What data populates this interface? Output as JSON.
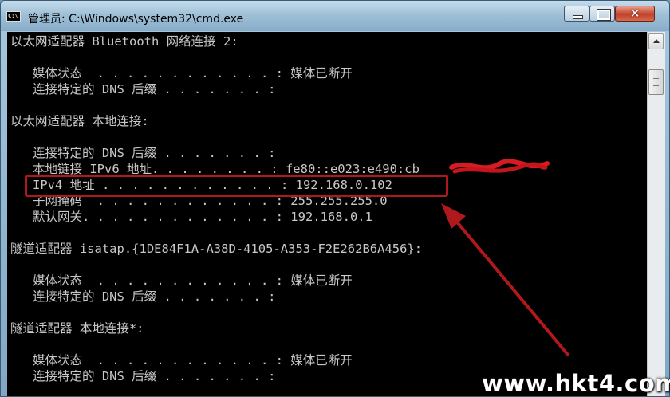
{
  "window": {
    "title": "管理员: C:\\Windows\\system32\\cmd.exe",
    "icon": "cmd-icon",
    "close_label": "×"
  },
  "console": {
    "lines": [
      "以太网适配器 Bluetooth 网络连接 2:",
      "",
      "   媒体状态  . . . . . . . . . . . . : 媒体已断开",
      "   连接特定的 DNS 后缀 . . . . . . . :",
      "",
      "以太网适配器 本地连接:",
      "",
      "   连接特定的 DNS 后缀 . . . . . . . :",
      "   本地链接 IPv6 地址. . . . . . . . : fe80::e023:e490:cb",
      "   IPv4 地址 . . . . . . . . . . . . : 192.168.0.102",
      "   子网掩码  . . . . . . . . . . . . : 255.255.255.0",
      "   默认网关. . . . . . . . . . . . . : 192.168.0.1",
      "",
      "隧道适配器 isatap.{1DE84F1A-A38D-4105-A353-F2E262B6A456}:",
      "",
      "   媒体状态  . . . . . . . . . . . . : 媒体已断开",
      "   连接特定的 DNS 后缀 . . . . . . . :",
      "",
      "隧道适配器 本地连接*:",
      "",
      "   媒体状态  . . . . . . . . . . . . : 媒体已断开",
      "   连接特定的 DNS 后缀 . . . . . . . :"
    ]
  },
  "annotation": {
    "highlight_color": "#b0191c",
    "redaction": "scribble-redaction"
  },
  "watermark": "www.hkt4.com"
}
